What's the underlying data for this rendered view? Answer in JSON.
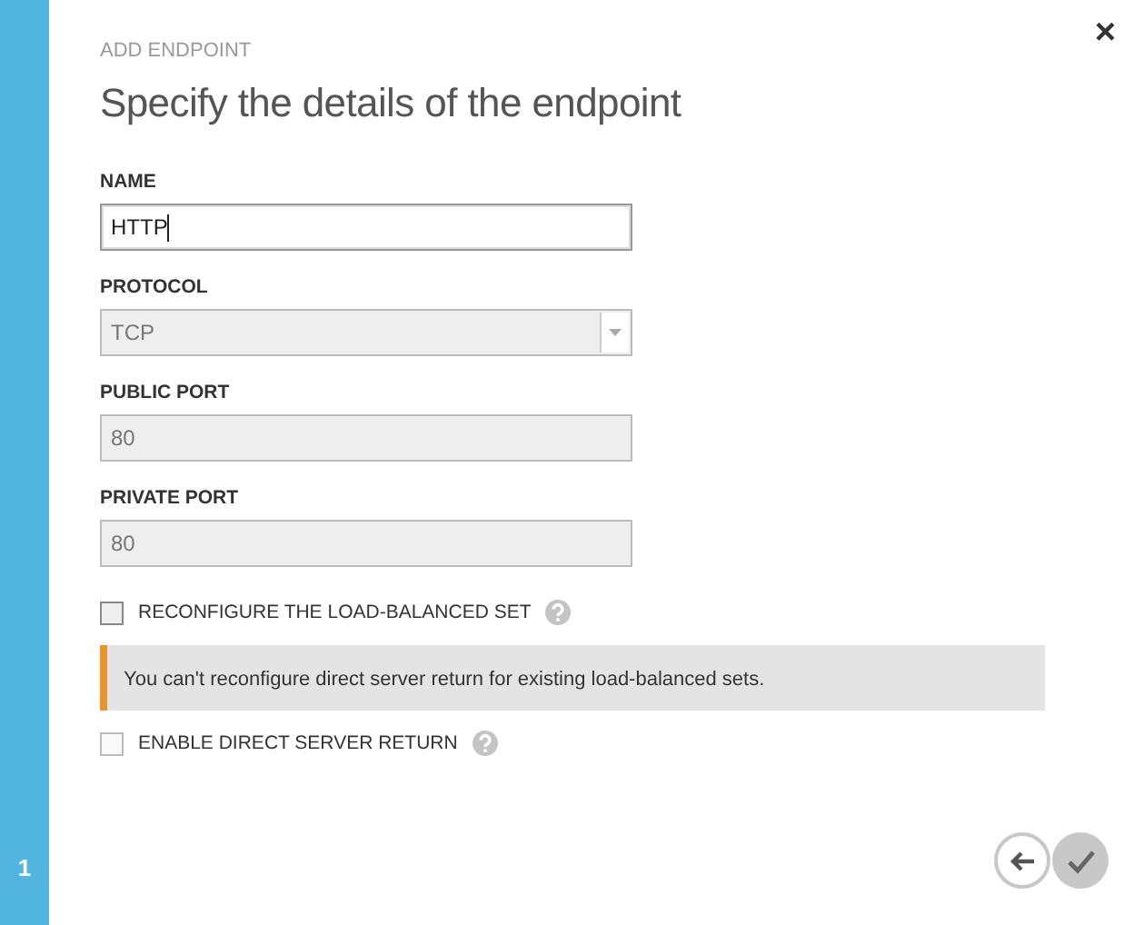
{
  "sidebar": {
    "step": "1"
  },
  "close": "×",
  "eyebrow": "ADD ENDPOINT",
  "title": "Specify the details of the endpoint",
  "fields": [
    {
      "label": "NAME",
      "kind": "text",
      "value": "HTTP",
      "disabled": false,
      "focused": true
    },
    {
      "label": "PROTOCOL",
      "kind": "select",
      "value": "TCP",
      "disabled": true,
      "focused": false
    },
    {
      "label": "PUBLIC PORT",
      "kind": "text",
      "value": "80",
      "disabled": true,
      "focused": false
    },
    {
      "label": "PRIVATE PORT",
      "kind": "text",
      "value": "80",
      "disabled": true,
      "focused": false
    }
  ],
  "options": [
    {
      "kind": "checkbox",
      "label": "RECONFIGURE THE LOAD-BALANCED SET",
      "checked": false,
      "disabled": false
    },
    {
      "kind": "notice",
      "text": "You can't reconfigure direct server return for existing load-balanced sets."
    },
    {
      "kind": "checkbox",
      "label": "ENABLE DIRECT SERVER RETURN",
      "checked": false,
      "disabled": true
    }
  ]
}
